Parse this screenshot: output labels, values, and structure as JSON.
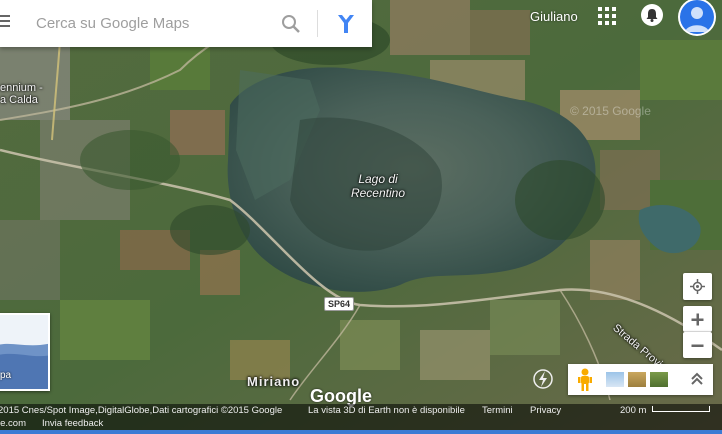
{
  "search": {
    "placeholder": "Cerca su Google Maps"
  },
  "user": {
    "name": "Giuliano"
  },
  "map": {
    "lake_label_line1": "Lago di",
    "lake_label_line2": "Recentino",
    "place_label_line1": "ennium -",
    "place_label_line2": "a Calda",
    "village_label": "Miriano",
    "road_shield": "SP64",
    "road_label": "Strada Provin",
    "watermark": "© 2015 Google"
  },
  "minimap": {
    "label": "pa"
  },
  "logo": "Google",
  "footer": {
    "copyright": "2015 Cnes/Spot Image,DigitalGlobe,Dati cartografici ©2015 Google",
    "notice_3d": "La vista 3D di Earth non è disponibile",
    "terms": "Termini",
    "privacy": "Privacy",
    "scale": "200 m",
    "site": "le.com",
    "feedback": "Invia feedback"
  },
  "icons": {
    "menu": "menu-icon",
    "search": "search-icon",
    "directions": "directions-icon",
    "apps": "apps-grid-icon",
    "notifications": "bell-icon",
    "avatar": "user-avatar-icon",
    "locate": "my-location-icon",
    "zoom_in": "plus-icon",
    "zoom_out": "minus-icon",
    "pegman": "pegman-icon",
    "expand": "chevron-up-icon",
    "earth": "lightning-icon"
  },
  "colors": {
    "accent": "#2a73e8",
    "directions": "#4285f4",
    "pegman": "#f9ab00"
  }
}
